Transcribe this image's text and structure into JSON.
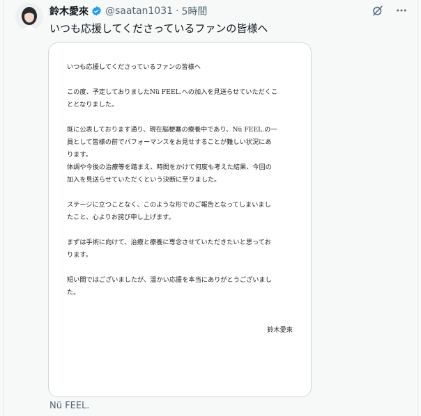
{
  "tweet": {
    "author_name": "鈴木愛來",
    "handle": "@saatan1031",
    "separator": "·",
    "time": "5時間",
    "text": "いつも応援してくださっているファンの皆様へ",
    "footer": "Nü FEEL."
  },
  "icons": {
    "verified": "verified-badge-icon",
    "grok": "grok-icon",
    "more": "more-icon"
  },
  "letter": {
    "greeting": "いつも応援してくださっているファンの皆様へ",
    "p1_l1": "この度、予定しておりましたNü FEEL.への加入を見送らせていただくこ",
    "p1_l2": "ととなりました。",
    "p2_l1": "既に公表しております通り、現在脳梗塞の療養中であり、Nü FEEL.の一",
    "p2_l2": "員として皆様の前でパフォーマンスをお見せすることが難しい状況にあ",
    "p2_l3": "ります。",
    "p3_l1": "体調や今後の治療等を踏まえ、時間をかけて何度も考えた結果、今回の",
    "p3_l2": "加入を見送らせていただくという決断に至りました。",
    "p4_l1": "ステージに立つことなく、このような形でのご報告となってしまいまし",
    "p4_l2": "たこと、心よりお詫び申し上げます。",
    "p5_l1": "まずは手術に向けて、治療と療養に専念させていただきたいと思ってお",
    "p5_l2": "ります。",
    "p6_l1": "短い間ではございましたが、温かい応援を本当にありがとうございまし",
    "p6_l2": "た。",
    "signature": "鈴木愛來"
  },
  "colors": {
    "verified_blue": "#1d9bf0",
    "text_primary": "#0f1419",
    "text_secondary": "#536471"
  }
}
